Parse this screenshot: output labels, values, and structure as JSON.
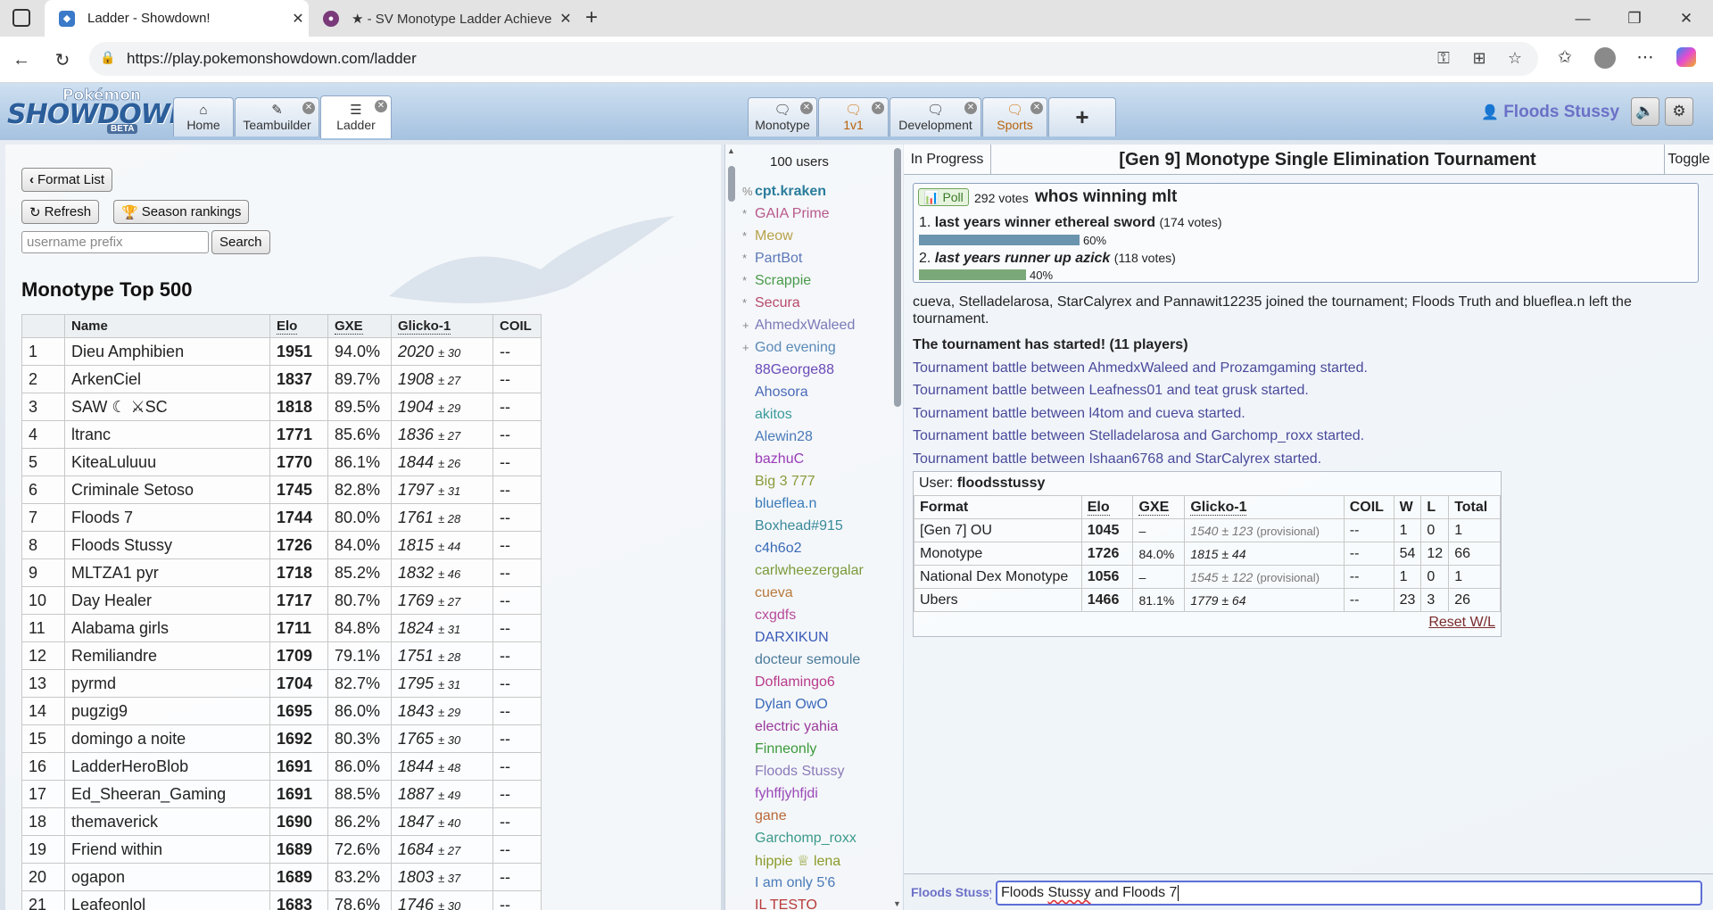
{
  "browser": {
    "tabs": [
      {
        "title": "Ladder - Showdown!",
        "active": true
      },
      {
        "title": "★ - SV Monotype Ladder Achieve",
        "active": false
      }
    ],
    "url": "https://play.pokemonshowdown.com/ladder"
  },
  "header": {
    "logo": {
      "top": "Pokémon",
      "main": "SHOWDOWN!",
      "badge": "BETA"
    },
    "left_tabs": [
      {
        "label": "Home",
        "icon": "home-icon"
      },
      {
        "label": "Teambuilder",
        "icon": "edit-icon"
      },
      {
        "label": "Ladder",
        "icon": "list-icon"
      }
    ],
    "room_tabs": [
      {
        "label": "Monotype",
        "icon": "chat-icon"
      },
      {
        "label": "1v1",
        "icon": "chat-icon"
      },
      {
        "label": "Development",
        "icon": "chat-icon"
      },
      {
        "label": "Sports",
        "icon": "chat-icon"
      },
      {
        "label": "+"
      }
    ],
    "username": "Floods Stussy"
  },
  "ladder": {
    "format_list_label": "Format List",
    "refresh_label": "Refresh",
    "season_label": "Season rankings",
    "search_placeholder": "username prefix",
    "search_label": "Search",
    "title": "Monotype Top 500",
    "columns": [
      "",
      "Name",
      "Elo",
      "GXE",
      "Glicko-1",
      "COIL"
    ],
    "rows": [
      {
        "rank": "1",
        "name": "Dieu Amphibien",
        "elo": "1951",
        "gxe": "94.0%",
        "glicko": "2020",
        "dev": "± 30",
        "coil": "--"
      },
      {
        "rank": "2",
        "name": "ArkenCiel",
        "elo": "1837",
        "gxe": "89.7%",
        "glicko": "1908",
        "dev": "± 27",
        "coil": "--"
      },
      {
        "rank": "3",
        "name": "SAW ☾ ⚔SC",
        "elo": "1818",
        "gxe": "89.5%",
        "glicko": "1904",
        "dev": "± 29",
        "coil": "--"
      },
      {
        "rank": "4",
        "name": "ltranc",
        "elo": "1771",
        "gxe": "85.6%",
        "glicko": "1836",
        "dev": "± 27",
        "coil": "--"
      },
      {
        "rank": "5",
        "name": "KiteaLuluuu",
        "elo": "1770",
        "gxe": "86.1%",
        "glicko": "1844",
        "dev": "± 26",
        "coil": "--"
      },
      {
        "rank": "6",
        "name": "Criminale Setoso",
        "elo": "1745",
        "gxe": "82.8%",
        "glicko": "1797",
        "dev": "± 31",
        "coil": "--"
      },
      {
        "rank": "7",
        "name": "Floods 7",
        "elo": "1744",
        "gxe": "80.0%",
        "glicko": "1761",
        "dev": "± 28",
        "coil": "--"
      },
      {
        "rank": "8",
        "name": "Floods Stussy",
        "elo": "1726",
        "gxe": "84.0%",
        "glicko": "1815",
        "dev": "± 44",
        "coil": "--"
      },
      {
        "rank": "9",
        "name": "MLTZA1 pyr",
        "elo": "1718",
        "gxe": "85.2%",
        "glicko": "1832",
        "dev": "± 46",
        "coil": "--"
      },
      {
        "rank": "10",
        "name": "Day Healer",
        "elo": "1717",
        "gxe": "80.7%",
        "glicko": "1769",
        "dev": "± 27",
        "coil": "--"
      },
      {
        "rank": "11",
        "name": "Alabama girls",
        "elo": "1711",
        "gxe": "84.8%",
        "glicko": "1824",
        "dev": "± 31",
        "coil": "--"
      },
      {
        "rank": "12",
        "name": "Remiliandre",
        "elo": "1709",
        "gxe": "79.1%",
        "glicko": "1751",
        "dev": "± 28",
        "coil": "--"
      },
      {
        "rank": "13",
        "name": "pyrmd",
        "elo": "1704",
        "gxe": "82.7%",
        "glicko": "1795",
        "dev": "± 31",
        "coil": "--"
      },
      {
        "rank": "14",
        "name": "pugzig9",
        "elo": "1695",
        "gxe": "86.0%",
        "glicko": "1843",
        "dev": "± 29",
        "coil": "--"
      },
      {
        "rank": "15",
        "name": "domingo a noite",
        "elo": "1692",
        "gxe": "80.3%",
        "glicko": "1765",
        "dev": "± 30",
        "coil": "--"
      },
      {
        "rank": "16",
        "name": "LadderHeroBlob",
        "elo": "1691",
        "gxe": "86.0%",
        "glicko": "1844",
        "dev": "± 48",
        "coil": "--"
      },
      {
        "rank": "17",
        "name": "Ed_Sheeran_Gaming",
        "elo": "1691",
        "gxe": "88.5%",
        "glicko": "1887",
        "dev": "± 49",
        "coil": "--"
      },
      {
        "rank": "18",
        "name": "themaverick",
        "elo": "1690",
        "gxe": "86.2%",
        "glicko": "1847",
        "dev": "± 40",
        "coil": "--"
      },
      {
        "rank": "19",
        "name": "Friend within",
        "elo": "1689",
        "gxe": "72.6%",
        "glicko": "1684",
        "dev": "± 27",
        "coil": "--"
      },
      {
        "rank": "20",
        "name": "ogapon",
        "elo": "1689",
        "gxe": "83.2%",
        "glicko": "1803",
        "dev": "± 37",
        "coil": "--"
      },
      {
        "rank": "21",
        "name": "Leafeonlol",
        "elo": "1683",
        "gxe": "78.6%",
        "glicko": "1746",
        "dev": "± 30",
        "coil": "--"
      }
    ]
  },
  "userlist": {
    "count": "100 users",
    "users": [
      {
        "group": "%",
        "name": "cpt.kraken",
        "color": "#2b7d9c",
        "bold": true
      },
      {
        "group": "*",
        "name": "GAIA Prime",
        "color": "#b8598c"
      },
      {
        "group": "*",
        "name": "Meow",
        "color": "#b8a24a"
      },
      {
        "group": "*",
        "name": "PartBot",
        "color": "#5d77b8"
      },
      {
        "group": "*",
        "name": "Scrappie",
        "color": "#4a9a4a"
      },
      {
        "group": "*",
        "name": "Secura",
        "color": "#b84a6a"
      },
      {
        "group": "+",
        "name": "AhmedxWaleed",
        "color": "#7a7ab8"
      },
      {
        "group": "+",
        "name": "God evening",
        "color": "#5a8ab8"
      },
      {
        "group": "",
        "name": "88George88",
        "color": "#6a4ab8"
      },
      {
        "group": "",
        "name": "Ahosora",
        "color": "#4a6ab8"
      },
      {
        "group": "",
        "name": "akitos",
        "color": "#3a9a9a"
      },
      {
        "group": "",
        "name": "Alewin28",
        "color": "#4a7ab8"
      },
      {
        "group": "",
        "name": "bazhuC",
        "color": "#9a3ab8"
      },
      {
        "group": "",
        "name": "Big 3 777",
        "color": "#8a9a3a"
      },
      {
        "group": "",
        "name": "blueflea.n",
        "color": "#3a7ab8"
      },
      {
        "group": "",
        "name": "Boxhead#915",
        "color": "#3a8a9a"
      },
      {
        "group": "",
        "name": "c4h6o2",
        "color": "#3a6ab8"
      },
      {
        "group": "",
        "name": "carlwheezergalar",
        "color": "#7a9a3a"
      },
      {
        "group": "",
        "name": "cueva",
        "color": "#b8783a"
      },
      {
        "group": "",
        "name": "cxgdfs",
        "color": "#b84a9a"
      },
      {
        "group": "",
        "name": "DARXIKUN",
        "color": "#3a5ab8"
      },
      {
        "group": "",
        "name": "docteur semoule",
        "color": "#4a7a9a"
      },
      {
        "group": "",
        "name": "Doflamingo6",
        "color": "#b83a8a"
      },
      {
        "group": "",
        "name": "Dylan OwO",
        "color": "#3a6ab8"
      },
      {
        "group": "",
        "name": "electric yahia",
        "color": "#9a3a9a"
      },
      {
        "group": "",
        "name": "Finneonly",
        "color": "#3a9a3a"
      },
      {
        "group": "",
        "name": "Floods Stussy",
        "color": "#8a7ab8"
      },
      {
        "group": "",
        "name": "fyhffjyhfjdi",
        "color": "#9a4ab8"
      },
      {
        "group": "",
        "name": "gane",
        "color": "#b8683a"
      },
      {
        "group": "",
        "name": "Garchomp_roxx",
        "color": "#3a9a8a"
      },
      {
        "group": "",
        "name": "hippie ♕ lena",
        "color": "#8a9a2a"
      },
      {
        "group": "",
        "name": "I am only 5'6",
        "color": "#4a7ab8"
      },
      {
        "group": "",
        "name": "IL TESTO",
        "color": "#b83a3a"
      }
    ]
  },
  "tournament": {
    "status": "In Progress",
    "title": "[Gen 9] Monotype Single Elimination Tournament",
    "toggle_label": "Toggle",
    "poll": {
      "badge": "Poll",
      "votes": "292 votes",
      "question": "whos winning mlt",
      "options": [
        {
          "num": "1.",
          "text": "last years winner ethereal sword",
          "votes": "(174 votes)",
          "pct": "60%",
          "fraction": 0.6,
          "italic": false
        },
        {
          "num": "2.",
          "text": "last years runner up azick",
          "votes": "(118 votes)",
          "pct": "40%",
          "fraction": 0.4,
          "italic": true
        }
      ]
    },
    "messages": [
      {
        "text": "cueva, Stelladelarosa, StarCalyrex and Pannawit12235 joined the tournament; Floods Truth and blueflea.n left the tournament.",
        "type": "normal"
      },
      {
        "text": "The tournament has started! (11 players)",
        "type": "bold"
      },
      {
        "text": "Tournament battle between AhmedxWaleed and Prozamgaming started.",
        "type": "battle"
      },
      {
        "text": "Tournament battle between Leafness01 and teat grusk started.",
        "type": "battle"
      },
      {
        "text": "Tournament battle between l4tom and cueva started.",
        "type": "battle"
      },
      {
        "text": "Tournament battle between Stelladelarosa and Garchomp_roxx started.",
        "type": "battle"
      },
      {
        "text": "Tournament battle between Ishaan6768 and StarCalyrex started.",
        "type": "battle"
      }
    ],
    "user_rank": {
      "label": "User:",
      "user": "floodsstussy",
      "columns": [
        "Format",
        "Elo",
        "GXE",
        "Glicko-1",
        "COIL",
        "W",
        "L",
        "Total"
      ],
      "rows": [
        {
          "format": "[Gen 7] OU",
          "elo": "1045",
          "gxe": "–",
          "glicko": "1540 ± 123",
          "prov": "(provisional)",
          "coil": "--",
          "w": "1",
          "l": "0",
          "total": "1"
        },
        {
          "format": "Monotype",
          "elo": "1726",
          "gxe": "84.0%",
          "glicko": "1815 ± 44",
          "prov": "",
          "coil": "--",
          "w": "54",
          "l": "12",
          "total": "66"
        },
        {
          "format": "National Dex Monotype",
          "elo": "1056",
          "gxe": "–",
          "glicko": "1545 ± 122",
          "prov": "(provisional)",
          "coil": "--",
          "w": "1",
          "l": "0",
          "total": "1"
        },
        {
          "format": "Ubers",
          "elo": "1466",
          "gxe": "81.1%",
          "glicko": "1779 ± 64",
          "prov": "",
          "coil": "--",
          "w": "23",
          "l": "3",
          "total": "26"
        }
      ],
      "reset_label": "Reset W/L"
    },
    "chat": {
      "name": "Floods Stussy",
      "input_pre": "Floods ",
      "input_sq": "Stussy",
      "input_post": " and Floods 7"
    }
  }
}
